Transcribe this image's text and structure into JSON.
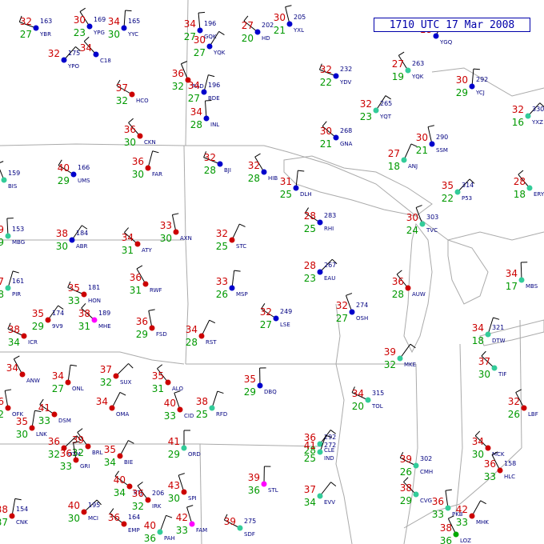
{
  "title": "1710 UTC 17 Mar 2008",
  "colors": {
    "temperature": "#cc0000",
    "dewpoint": "#009900",
    "pressure": "#000080",
    "weather": "#cc00cc",
    "boundary": "#aaaaaa",
    "wind": "#000000"
  },
  "legend_of_marks": {
    "station_dot_colors": [
      "#0000cc",
      "#cc0000",
      "#ff00ff",
      "#33cc99",
      "#00aa00"
    ]
  },
  "stations": [
    {
      "t": "32",
      "td": "27",
      "p": "163",
      "id": "YBR",
      "c": "#0000cc"
    },
    {
      "t": "30",
      "td": "23",
      "p": "169",
      "id": "YPG",
      "c": "#0000cc"
    },
    {
      "t": "34",
      "td": "30",
      "p": "165",
      "id": "YYC",
      "c": "#0000cc"
    },
    {
      "t": "32",
      "td": "",
      "p": "175",
      "id": "YPO",
      "c": "#0000cc"
    },
    {
      "t": "34",
      "td": "",
      "p": "",
      "id": "C18",
      "c": "#0000cc"
    },
    {
      "t": "34",
      "td": "27",
      "p": "196",
      "id": "GQK",
      "c": "#0000cc"
    },
    {
      "t": "30",
      "td": "27",
      "p": "",
      "id": "YQK",
      "c": "#0000cc"
    },
    {
      "t": "27",
      "td": "20",
      "p": "202",
      "id": "HD",
      "c": "#0000cc"
    },
    {
      "t": "30",
      "td": "21",
      "p": "205",
      "id": "YXL",
      "c": "#0000cc"
    },
    {
      "t": "18",
      "td": "",
      "p": "",
      "id": "YGQ",
      "c": "#0000cc"
    },
    {
      "t": "37",
      "td": "32",
      "p": "",
      "id": "HCO",
      "c": "#cc0000"
    },
    {
      "t": "36",
      "td": "32",
      "p": "",
      "id": "RAD",
      "c": "#cc0000"
    },
    {
      "t": "34",
      "td": "27",
      "p": "196",
      "id": "BDE",
      "c": "#0000cc"
    },
    {
      "t": "32",
      "td": "22",
      "p": "232",
      "id": "YDV",
      "c": "#0000cc"
    },
    {
      "t": "27",
      "td": "19",
      "p": "263",
      "id": "YQK",
      "c": "#33cc99"
    },
    {
      "t": "30",
      "td": "29",
      "p": "292",
      "id": "YCJ",
      "c": "#0000cc"
    },
    {
      "t": "32",
      "td": "16",
      "p": "330",
      "id": "YXZ",
      "c": "#33cc99"
    },
    {
      "t": "36",
      "td": "30",
      "p": "",
      "id": "CKN",
      "c": "#cc0000"
    },
    {
      "t": "34",
      "td": "28",
      "p": "",
      "id": "INL",
      "c": "#0000cc"
    },
    {
      "t": "32",
      "td": "23",
      "p": "265",
      "id": "YQT",
      "c": "#33cc99"
    },
    {
      "t": "30",
      "td": "21",
      "p": "268",
      "id": "GNA",
      "c": "#0000cc"
    },
    {
      "t": "30",
      "td": "21",
      "p": "290",
      "id": "SSM",
      "c": "#0000cc"
    },
    {
      "t": "27",
      "td": "18",
      "p": "",
      "id": "ANJ",
      "c": "#33cc99"
    },
    {
      "t": "40",
      "td": "29",
      "p": "166",
      "id": "UMS",
      "c": "#0000cc"
    },
    {
      "t": "29",
      "td": "",
      "p": "159",
      "id": "BIS",
      "c": "#33cc99"
    },
    {
      "t": "36",
      "td": "30",
      "p": "",
      "id": "FAR",
      "c": "#cc0000"
    },
    {
      "t": "32",
      "td": "28",
      "p": "",
      "id": "BJI",
      "c": "#0000cc"
    },
    {
      "t": "32",
      "td": "28",
      "p": "",
      "id": "HIB",
      "c": "#0000cc"
    },
    {
      "t": "31",
      "td": "25",
      "p": "",
      "id": "DLH",
      "c": "#0000cc"
    },
    {
      "t": "35",
      "td": "22",
      "p": "314",
      "id": "P53",
      "c": "#33cc99"
    },
    {
      "t": "28",
      "td": "18",
      "p": "",
      "id": "ERY",
      "c": "#33cc99"
    },
    {
      "t": "39",
      "td": "29",
      "p": "153",
      "id": "MBG",
      "c": "#33cc99"
    },
    {
      "t": "38",
      "td": "30",
      "p": "184",
      "id": "ABR",
      "c": "#0000cc"
    },
    {
      "t": "34",
      "td": "31",
      "p": "",
      "id": "ATY",
      "c": "#cc0000"
    },
    {
      "t": "33",
      "td": "30",
      "p": "",
      "id": "AXN",
      "c": "#cc0000"
    },
    {
      "t": "32",
      "td": "25",
      "p": "",
      "id": "STC",
      "c": "#cc0000"
    },
    {
      "t": "28",
      "td": "25",
      "p": "283",
      "id": "RHI",
      "c": "#0000cc"
    },
    {
      "t": "30",
      "td": "24",
      "p": "303",
      "id": "TVC",
      "c": "#33cc99"
    },
    {
      "t": "37",
      "td": "28",
      "p": "161",
      "id": "PIR",
      "c": "#33cc99"
    },
    {
      "t": "35",
      "td": "33",
      "p": "181",
      "id": "HON",
      "c": "#cc0000"
    },
    {
      "t": "36",
      "td": "31",
      "p": "",
      "id": "RWF",
      "c": "#cc0000"
    },
    {
      "t": "33",
      "td": "26",
      "p": "",
      "id": "MSP",
      "c": "#0000cc"
    },
    {
      "t": "28",
      "td": "23",
      "p": "267",
      "id": "EAU",
      "c": "#0000cc"
    },
    {
      "t": "36",
      "td": "28",
      "p": "",
      "id": "AUW",
      "c": "#cc0000"
    },
    {
      "t": "34",
      "td": "17",
      "p": "",
      "id": "MBS",
      "c": "#33cc99"
    },
    {
      "t": "35",
      "td": "29",
      "p": "174",
      "id": "9V9",
      "c": "#cc0000"
    },
    {
      "t": "38",
      "td": "31",
      "p": "189",
      "id": "MHE",
      "c": "#ff00ff"
    },
    {
      "t": "36",
      "td": "29",
      "p": "",
      "id": "FSD",
      "c": "#cc0000"
    },
    {
      "t": "34",
      "td": "28",
      "p": "",
      "id": "RST",
      "c": "#cc0000"
    },
    {
      "t": "32",
      "td": "27",
      "p": "249",
      "id": "LSE",
      "c": "#0000cc"
    },
    {
      "t": "32",
      "td": "27",
      "p": "274",
      "id": "OSH",
      "c": "#0000cc"
    },
    {
      "t": "34",
      "td": "18",
      "p": "321",
      "id": "DTW",
      "c": "#33cc99"
    },
    {
      "t": "38",
      "td": "34",
      "p": "",
      "id": "ICR",
      "c": "#cc0000"
    },
    {
      "t": "34",
      "td": "",
      "p": "",
      "id": "ANW",
      "c": "#cc0000"
    },
    {
      "t": "34",
      "td": "27",
      "p": "",
      "id": "ONL",
      "c": "#cc0000"
    },
    {
      "t": "37",
      "td": "32",
      "p": "",
      "id": "SUX",
      "c": "#cc0000"
    },
    {
      "t": "35",
      "td": "31",
      "p": "",
      "id": "ALO",
      "c": "#cc0000"
    },
    {
      "t": "35",
      "td": "29",
      "p": "",
      "id": "DBQ",
      "c": "#0000cc"
    },
    {
      "t": "39",
      "td": "32",
      "p": "",
      "id": "MKE",
      "c": "#33cc99"
    },
    {
      "t": "37",
      "td": "30",
      "p": "",
      "id": "TIF",
      "c": "#33cc99"
    },
    {
      "t": "36",
      "td": "32",
      "p": "",
      "id": "OFK",
      "c": "#cc0000"
    },
    {
      "t": "34",
      "td": "",
      "p": "",
      "id": "OMA",
      "c": "#cc0000"
    },
    {
      "t": "41",
      "td": "33",
      "p": "",
      "id": "DSM",
      "c": "#cc0000"
    },
    {
      "t": "40",
      "td": "33",
      "p": "",
      "id": "CID",
      "c": "#cc0000"
    },
    {
      "t": "38",
      "td": "25",
      "p": "",
      "id": "RFD",
      "c": "#33cc99"
    },
    {
      "t": "34",
      "td": "20",
      "p": "315",
      "id": "TOL",
      "c": "#33cc99"
    },
    {
      "t": "32",
      "td": "26",
      "p": "",
      "id": "LBF",
      "c": "#cc0000"
    },
    {
      "t": "35",
      "td": "30",
      "p": "",
      "id": "LNK",
      "c": "#cc0000"
    },
    {
      "t": "36",
      "td": "32",
      "p": "",
      "id": "OTM",
      "c": "#cc0000"
    },
    {
      "t": "39",
      "td": "32",
      "p": "",
      "id": "BRL",
      "c": "#cc0000"
    },
    {
      "t": "41",
      "td": "29",
      "p": "",
      "id": "ORD",
      "c": "#33cc99"
    },
    {
      "t": "36",
      "td": "28",
      "p": "292",
      "id": "CLE",
      "c": "#33cc99"
    },
    {
      "t": "34",
      "td": "30",
      "p": "",
      "id": "MCK",
      "c": "#cc0000"
    },
    {
      "t": "36",
      "td": "33",
      "p": "",
      "id": "GRI",
      "c": "#cc0000"
    },
    {
      "t": "35",
      "td": "34",
      "p": "",
      "id": "BIE",
      "c": "#cc0000"
    },
    {
      "t": "40",
      "td": "34",
      "p": "",
      "id": "STJ",
      "c": "#cc0000"
    },
    {
      "t": "43",
      "td": "30",
      "p": "",
      "id": "SPI",
      "c": "#cc0000"
    },
    {
      "t": "41",
      "td": "25",
      "p": "272",
      "id": "IND",
      "c": "#33cc99"
    },
    {
      "t": "39",
      "td": "26",
      "p": "302",
      "id": "CMH",
      "c": "#33cc99"
    },
    {
      "t": "36",
      "td": "33",
      "p": "158",
      "id": "HLC",
      "c": "#cc0000"
    },
    {
      "t": "38",
      "td": "37",
      "p": "154",
      "id": "CNK",
      "c": "#cc0000"
    },
    {
      "t": "40",
      "td": "30",
      "p": "195",
      "id": "MCI",
      "c": "#cc0000"
    },
    {
      "t": "36",
      "td": "32",
      "p": "206",
      "id": "IRK",
      "c": "#cc0000"
    },
    {
      "t": "39",
      "td": "36",
      "p": "",
      "id": "STL",
      "c": "#ff00ff"
    },
    {
      "t": "37",
      "td": "34",
      "p": "",
      "id": "EVV",
      "c": "#33cc99"
    },
    {
      "t": "38",
      "td": "29",
      "p": "",
      "id": "CVG",
      "c": "#33cc99"
    },
    {
      "t": "36",
      "td": "33",
      "p": "",
      "id": "PKB",
      "c": "#33cc99"
    },
    {
      "t": "42",
      "td": "33",
      "p": "",
      "id": "MHK",
      "c": "#cc0000"
    },
    {
      "t": "36",
      "td": "",
      "p": "164",
      "id": "EMP",
      "c": "#cc0000"
    },
    {
      "t": "42",
      "td": "33",
      "p": "",
      "id": "FAM",
      "c": "#ff00ff"
    },
    {
      "t": "40",
      "td": "36",
      "p": "",
      "id": "PAH",
      "c": "#33cc99"
    },
    {
      "t": "39",
      "td": "",
      "p": "275",
      "id": "SDF",
      "c": "#33cc99"
    },
    {
      "t": "38",
      "td": "36",
      "p": "",
      "id": "LOZ",
      "c": "#00aa00"
    }
  ]
}
